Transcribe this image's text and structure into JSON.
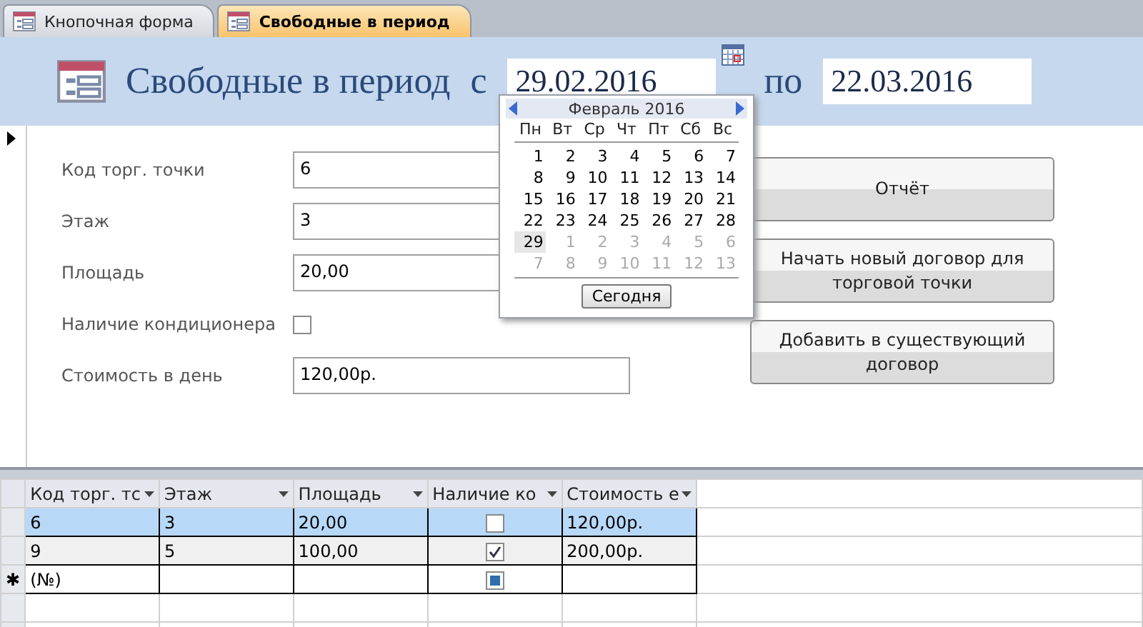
{
  "tabs": [
    {
      "label": "Кнопочная форма",
      "selected": false
    },
    {
      "label": "Свободные в период",
      "selected": true
    }
  ],
  "header": {
    "title": "Свободные в период",
    "from_label": "с",
    "from_date": "29.02.2016",
    "to_label": "по",
    "to_date": "22.03.2016"
  },
  "calendar": {
    "month": "Февраль 2016",
    "weekdays": [
      "Пн",
      "Вт",
      "Ср",
      "Чт",
      "Пт",
      "Сб",
      "Вс"
    ],
    "days": [
      {
        "text": "1",
        "current": true,
        "selected": false
      },
      {
        "text": "2",
        "current": true,
        "selected": false
      },
      {
        "text": "3",
        "current": true,
        "selected": false
      },
      {
        "text": "4",
        "current": true,
        "selected": false
      },
      {
        "text": "5",
        "current": true,
        "selected": false
      },
      {
        "text": "6",
        "current": true,
        "selected": false
      },
      {
        "text": "7",
        "current": true,
        "selected": false
      },
      {
        "text": "8",
        "current": true,
        "selected": false
      },
      {
        "text": "9",
        "current": true,
        "selected": false
      },
      {
        "text": "10",
        "current": true,
        "selected": false
      },
      {
        "text": "11",
        "current": true,
        "selected": false
      },
      {
        "text": "12",
        "current": true,
        "selected": false
      },
      {
        "text": "13",
        "current": true,
        "selected": false
      },
      {
        "text": "14",
        "current": true,
        "selected": false
      },
      {
        "text": "15",
        "current": true,
        "selected": false
      },
      {
        "text": "16",
        "current": true,
        "selected": false
      },
      {
        "text": "17",
        "current": true,
        "selected": false
      },
      {
        "text": "18",
        "current": true,
        "selected": false
      },
      {
        "text": "19",
        "current": true,
        "selected": false
      },
      {
        "text": "20",
        "current": true,
        "selected": false
      },
      {
        "text": "21",
        "current": true,
        "selected": false
      },
      {
        "text": "22",
        "current": true,
        "selected": false
      },
      {
        "text": "23",
        "current": true,
        "selected": false
      },
      {
        "text": "24",
        "current": true,
        "selected": false
      },
      {
        "text": "25",
        "current": true,
        "selected": false
      },
      {
        "text": "26",
        "current": true,
        "selected": false
      },
      {
        "text": "27",
        "current": true,
        "selected": false
      },
      {
        "text": "28",
        "current": true,
        "selected": false
      },
      {
        "text": "29",
        "current": true,
        "selected": true
      },
      {
        "text": "1",
        "current": false,
        "selected": false
      },
      {
        "text": "2",
        "current": false,
        "selected": false
      },
      {
        "text": "3",
        "current": false,
        "selected": false
      },
      {
        "text": "4",
        "current": false,
        "selected": false
      },
      {
        "text": "5",
        "current": false,
        "selected": false
      },
      {
        "text": "6",
        "current": false,
        "selected": false
      },
      {
        "text": "7",
        "current": false,
        "selected": false
      },
      {
        "text": "8",
        "current": false,
        "selected": false
      },
      {
        "text": "9",
        "current": false,
        "selected": false
      },
      {
        "text": "10",
        "current": false,
        "selected": false
      },
      {
        "text": "11",
        "current": false,
        "selected": false
      },
      {
        "text": "12",
        "current": false,
        "selected": false
      },
      {
        "text": "13",
        "current": false,
        "selected": false
      }
    ],
    "today_button": "Сегодня"
  },
  "fields": [
    {
      "kind": "text",
      "label": "Код торг. точки",
      "value": "6"
    },
    {
      "kind": "text",
      "label": "Этаж",
      "value": "3"
    },
    {
      "kind": "text",
      "label": "Площадь",
      "value": "20,00"
    },
    {
      "kind": "checkbox",
      "label": "Наличие кондиционера",
      "checked": false
    },
    {
      "kind": "text",
      "label": "Стоимость в день",
      "value": "120,00р."
    }
  ],
  "buttons": [
    "Отчёт",
    "Начать новый договор для торговой точки",
    "Добавить в существующий договор"
  ],
  "table": {
    "columns": [
      "Код торг. тс",
      "Этаж",
      "Площадь",
      "Наличие ко",
      "Стоимость е"
    ],
    "rows": [
      {
        "kind": "record",
        "cells": [
          "6",
          "3",
          "20,00",
          "",
          "120,00р."
        ],
        "checked": false,
        "selected": true
      },
      {
        "kind": "record",
        "cells": [
          "9",
          "5",
          "100,00",
          "",
          "200,00р."
        ],
        "checked": true,
        "selected": false
      },
      {
        "kind": "new",
        "marker": "✱",
        "cells": [
          "(№)",
          "",
          "",
          "",
          ""
        ],
        "selected": false
      }
    ]
  }
}
